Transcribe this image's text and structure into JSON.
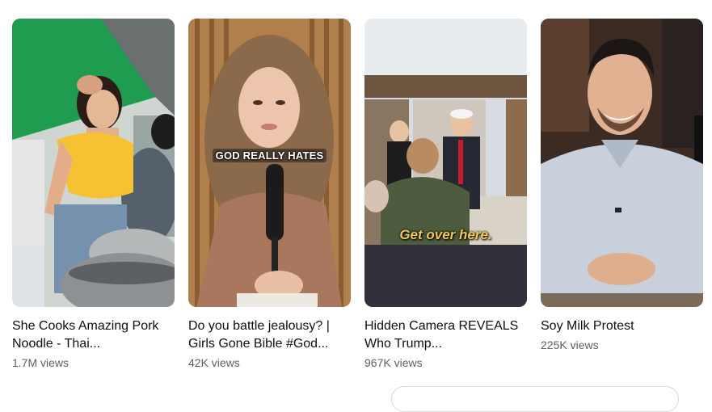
{
  "shorts": [
    {
      "title": "She Cooks Amazing Pork Noodle - Thai...",
      "views": "1.7M views",
      "overlay": ""
    },
    {
      "title": "Do you battle jealousy? | Girls Gone Bible #God...",
      "views": "42K views",
      "overlay": "GOD REALLY HATES"
    },
    {
      "title": "Hidden Camera REVEALS Who Trump...",
      "views": "967K views",
      "overlay": "Get over here."
    },
    {
      "title": "Soy Milk Protest",
      "views": "225K views",
      "overlay": ""
    }
  ],
  "colors": {
    "title": "#0f0f0f",
    "meta": "#606060",
    "background": "#ffffff"
  }
}
